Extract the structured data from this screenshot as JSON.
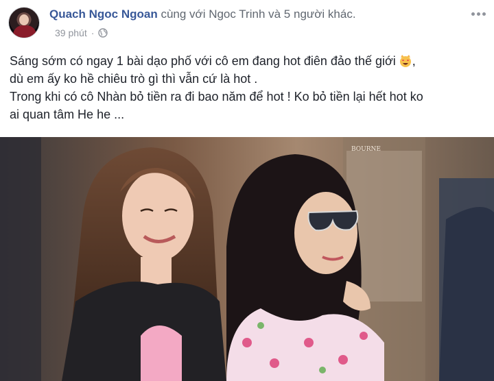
{
  "post": {
    "author": "Quach Ngoc Ngoan",
    "with_text": "cùng với Ngoc Trinh và 5 người khác.",
    "time": "39 phút",
    "separator": "·",
    "privacy_icon": "globe-icon",
    "more_icon": "more-options-icon",
    "text_lines": [
      "Sáng sớm có ngay 1 bài dạo phố với cô em đang hot điên đảo thế giới",
      "dù em ấy ko hề chiêu trò gì thì vẫn cứ là hot .",
      "Trong khi có cô Nhàn bỏ tiền ra đi bao năm để hot ! Ko bỏ tiền lại hết hot ko",
      "ai quan tâm He he ..."
    ],
    "emoji_icon": "smiling-cat-heart-eyes-icon",
    "emoji_trailing": ",",
    "photo_sign_text": "BOURNE"
  },
  "colors": {
    "author": "#385898",
    "meta": "#90949c",
    "text": "#1d2129"
  }
}
